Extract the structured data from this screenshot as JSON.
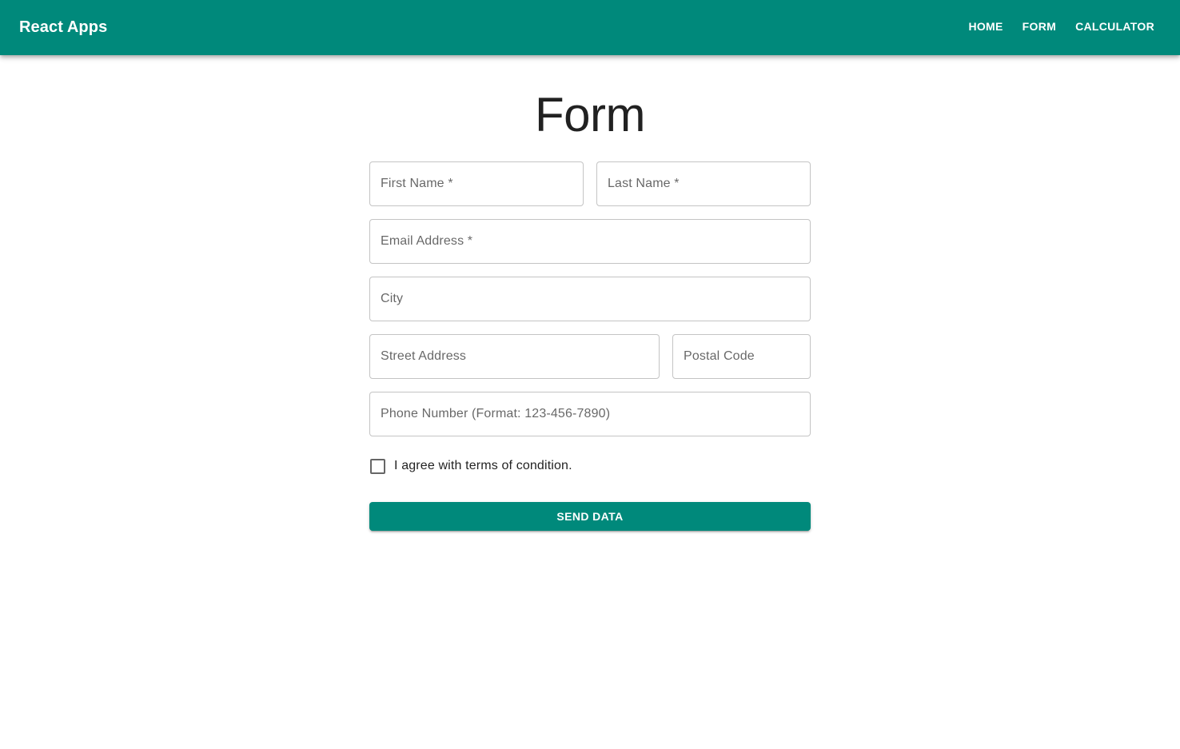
{
  "app": {
    "brand": "React Apps",
    "accent_color": "#00897b"
  },
  "nav": {
    "items": [
      {
        "label": "HOME"
      },
      {
        "label": "FORM"
      },
      {
        "label": "CALCULATOR"
      }
    ]
  },
  "page": {
    "title": "Form"
  },
  "form": {
    "first_name": {
      "label": "First Name *",
      "value": ""
    },
    "last_name": {
      "label": "Last Name *",
      "value": ""
    },
    "email": {
      "label": "Email Address *",
      "value": ""
    },
    "city": {
      "label": "City",
      "value": ""
    },
    "street": {
      "label": "Street Address",
      "value": ""
    },
    "postal": {
      "label": "Postal Code",
      "value": ""
    },
    "phone": {
      "label": "Phone Number (Format: 123-456-7890)",
      "value": ""
    },
    "terms": {
      "label": "I agree with terms of condition.",
      "checked": false
    },
    "submit_label": "SEND DATA"
  }
}
